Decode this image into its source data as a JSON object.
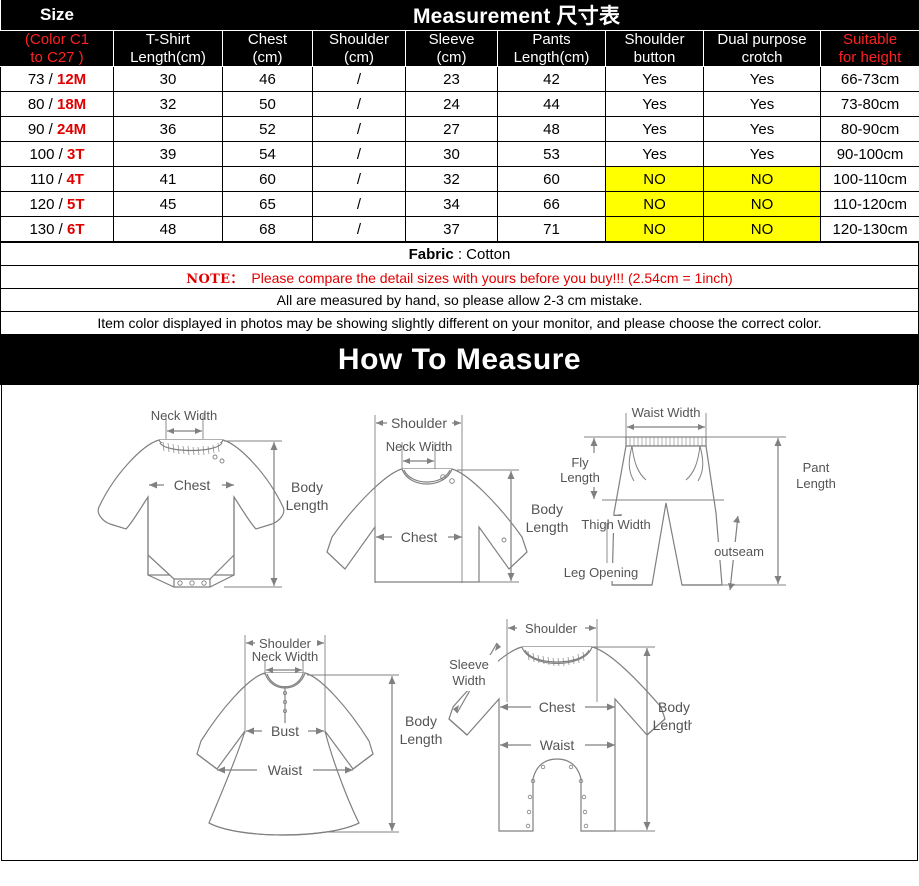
{
  "table": {
    "title_size": "Size",
    "title_measurement": "Measurement 尺寸表",
    "size_sub_line1": "(Color C1",
    "size_sub_line2": "to C27 )",
    "columns": [
      {
        "line1": "T-Shirt",
        "line2": "Length(cm)"
      },
      {
        "line1": "Chest",
        "line2": "(cm)"
      },
      {
        "line1": "Shoulder",
        "line2": "(cm)"
      },
      {
        "line1": "Sleeve",
        "line2": "(cm)"
      },
      {
        "line1": "Pants",
        "line2": "Length(cm)"
      },
      {
        "line1": "Shoulder",
        "line2": "button"
      },
      {
        "line1": "Dual purpose",
        "line2": "crotch"
      },
      {
        "line1": "Suitable",
        "line2": "for height"
      }
    ],
    "rows": [
      {
        "size_num": "73 / ",
        "size_age": "12M",
        "tshirt": "30",
        "chest": "46",
        "shoulder": "/",
        "sleeve": "23",
        "pants": "42",
        "button": "Yes",
        "crotch": "Yes",
        "height": "66-73cm",
        "highlight": false
      },
      {
        "size_num": "80 / ",
        "size_age": "18M",
        "tshirt": "32",
        "chest": "50",
        "shoulder": "/",
        "sleeve": "24",
        "pants": "44",
        "button": "Yes",
        "crotch": "Yes",
        "height": "73-80cm",
        "highlight": false
      },
      {
        "size_num": "90 / ",
        "size_age": "24M",
        "tshirt": "36",
        "chest": "52",
        "shoulder": "/",
        "sleeve": "27",
        "pants": "48",
        "button": "Yes",
        "crotch": "Yes",
        "height": "80-90cm",
        "highlight": false
      },
      {
        "size_num": "100 / ",
        "size_age": "3T",
        "tshirt": "39",
        "chest": "54",
        "shoulder": "/",
        "sleeve": "30",
        "pants": "53",
        "button": "Yes",
        "crotch": "Yes",
        "height": "90-100cm",
        "highlight": false
      },
      {
        "size_num": "110 / ",
        "size_age": "4T",
        "tshirt": "41",
        "chest": "60",
        "shoulder": "/",
        "sleeve": "32",
        "pants": "60",
        "button": "NO",
        "crotch": "NO",
        "height": "100-110cm",
        "highlight": true
      },
      {
        "size_num": "120 / ",
        "size_age": "5T",
        "tshirt": "45",
        "chest": "65",
        "shoulder": "/",
        "sleeve": "34",
        "pants": "66",
        "button": "NO",
        "crotch": "NO",
        "height": "110-120cm",
        "highlight": true
      },
      {
        "size_num": "130 / ",
        "size_age": "6T",
        "tshirt": "48",
        "chest": "68",
        "shoulder": "/",
        "sleeve": "37",
        "pants": "71",
        "button": "NO",
        "crotch": "NO",
        "height": "120-130cm",
        "highlight": true
      }
    ]
  },
  "notes": {
    "fabric_label": "Fabric",
    "fabric_value": " : Cotton",
    "note_keyword": "NOTE：",
    "note_text": "Please compare the detail sizes with yours before you buy!!! (2.54cm = 1inch)",
    "measure_note": "All are measured by hand, so please allow 2-3 cm mistake.",
    "color_note": "Item color displayed in photos may be showing slightly different on your monitor, and please choose the correct color."
  },
  "banner": {
    "title": "How To Measure"
  },
  "diagrams": {
    "bodysuit": {
      "name": "bodysuit",
      "labels": {
        "neck_width": "Neck Width",
        "chest": "Chest",
        "body_length_1": "Body",
        "body_length_2": "Length"
      }
    },
    "sweatshirt": {
      "name": "sweatshirt",
      "labels": {
        "shoulder": "Shoulder",
        "neck_width": "Neck Width",
        "chest": "Chest",
        "body_length_1": "Body",
        "body_length_2": "Length"
      }
    },
    "pants": {
      "name": "pants",
      "labels": {
        "waist_width": "Waist Width",
        "fly_1": "Fly",
        "fly_2": "Length",
        "thigh_width": "Thigh Width",
        "leg_opening": "Leg Opening",
        "outseam": "outseam",
        "pant_1": "Pant",
        "pant_2": "Length"
      }
    },
    "dress": {
      "name": "dress",
      "labels": {
        "shoulder": "Shoulder",
        "neck_width": "Neck Width",
        "bust": "Bust",
        "waist": "Waist",
        "body_length_1": "Body",
        "body_length_2": "Length"
      }
    },
    "romper": {
      "name": "romper",
      "labels": {
        "shoulder": "Shoulder",
        "sleeve_1": "Sleeve",
        "sleeve_2": "Width",
        "chest": "Chest",
        "waist": "Waist",
        "body_length_1": "Body",
        "body_length_2": "Length"
      }
    }
  },
  "colors": {
    "accent_red": "#e00000",
    "highlight_yellow": "#ffff00",
    "header_black": "#000000",
    "line_gray": "#808080"
  }
}
